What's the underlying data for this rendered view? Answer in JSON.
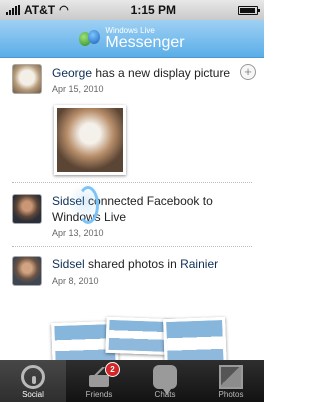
{
  "status_bar": {
    "carrier": "AT&T",
    "time": "1:15 PM"
  },
  "header": {
    "brand_top": "Windows Live",
    "brand_main": "Messenger"
  },
  "feed": {
    "items": [
      {
        "name": "George",
        "text": " has a new display picture",
        "date": "Apr 15, 2010"
      },
      {
        "name": "Sidsel",
        "text": " connected Facebook to Windows Live",
        "date": "Apr 13, 2010"
      },
      {
        "name": "Sidsel",
        "text": " shared photos in ",
        "place": "Rainier",
        "date": "Apr 8, 2010"
      }
    ]
  },
  "tabbar": {
    "tabs": [
      {
        "label": "Social"
      },
      {
        "label": "Friends",
        "badge": "2"
      },
      {
        "label": "Chats"
      },
      {
        "label": "Photos"
      }
    ]
  },
  "icons": {
    "signal": "signal-icon",
    "wifi": "wifi-icon",
    "battery": "battery-icon",
    "comment": "comment-icon",
    "social": "social-icon",
    "friends": "friends-icon",
    "chats": "chats-icon",
    "photos": "photos-icon"
  }
}
